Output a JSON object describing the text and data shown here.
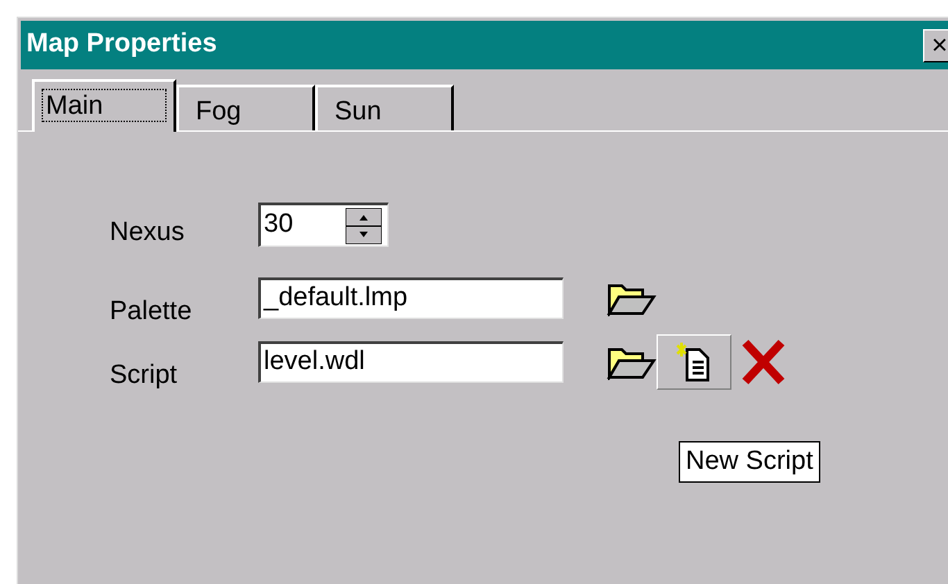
{
  "window": {
    "title": "Map Properties",
    "close": "×"
  },
  "tabs": [
    {
      "label": "Main",
      "selected": true
    },
    {
      "label": "Fog",
      "selected": false
    },
    {
      "label": "Sun",
      "selected": false
    }
  ],
  "nexus": {
    "label": "Nexus",
    "value": "30"
  },
  "palette": {
    "label": "Palette",
    "value": "_default.lmp"
  },
  "script": {
    "label": "Script",
    "value": "level.wdl"
  },
  "tooltip": "New Script"
}
